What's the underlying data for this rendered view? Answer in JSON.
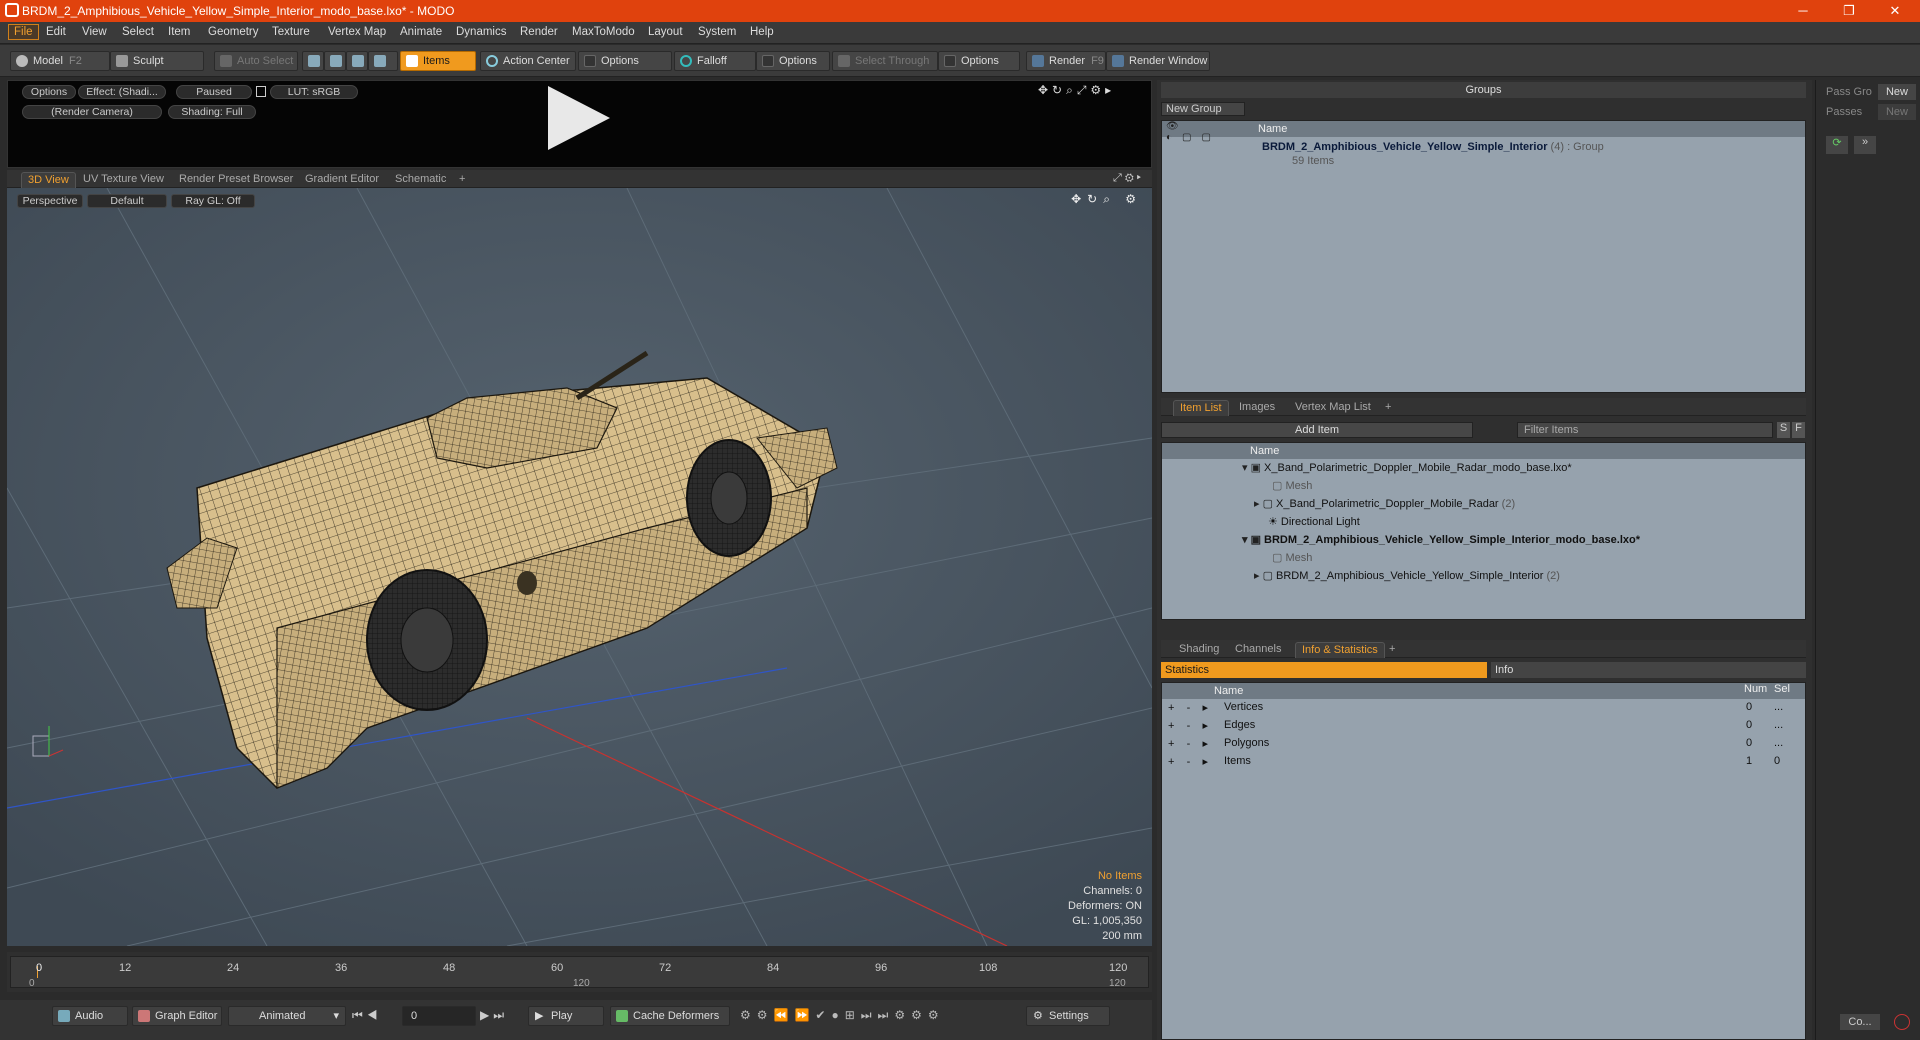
{
  "window": {
    "title": "BRDM_2_Amphibious_Vehicle_Yellow_Simple_Interior_modo_base.lxo* - MODO",
    "minimize": "─",
    "restore": "❐",
    "close": "✕"
  },
  "menu": [
    "File",
    "Edit",
    "View",
    "Select",
    "Item",
    "Geometry",
    "Texture",
    "Vertex Map",
    "Animate",
    "Dynamics",
    "Render",
    "MaxToModo",
    "Layout",
    "System",
    "Help"
  ],
  "toolbar": {
    "model": "Model",
    "model_key": "F2",
    "sculpt": "Sculpt",
    "auto_select": "Auto Select",
    "items": "Items",
    "action_center": "Action Center",
    "options1": "Options",
    "falloff": "Falloff",
    "options2": "Options",
    "select_through": "Select Through",
    "options3": "Options",
    "render": "Render",
    "render_key": "F9",
    "render_window": "Render Window"
  },
  "viewer": {
    "options": "Options",
    "effect": "Effect: (Shadi...",
    "paused": "Paused",
    "lut": "LUT: sRGB",
    "camera": "(Render Camera)",
    "shading": "Shading: Full"
  },
  "view_tabs": [
    "3D View",
    "UV Texture View",
    "Render Preset Browser",
    "Gradient Editor",
    "Schematic",
    "+"
  ],
  "viewport": {
    "perspective": "Perspective",
    "default": "Default",
    "raygl": "Ray GL: Off",
    "no_items": "No Items",
    "channels": "Channels: 0",
    "deformers": "Deformers: ON",
    "gl": "GL: 1,005,350",
    "unit": "200 mm"
  },
  "timeline": {
    "ticks": [
      "0",
      "12",
      "24",
      "36",
      "48",
      "60",
      "72",
      "84",
      "96",
      "108",
      "120"
    ],
    "sub_left": "0",
    "sub_mid": "120",
    "sub_right": "120"
  },
  "bottom": {
    "audio": "Audio",
    "graph_editor": "Graph Editor",
    "animated": "Animated",
    "frame": "0",
    "play": "Play",
    "cache": "Cache Deformers",
    "settings": "Settings"
  },
  "groups": {
    "title": "Groups",
    "new_group": "New Group",
    "col_name": "Name",
    "item_name": "BRDM_2_Amphibious_Vehicle_Yellow_Simple_Interior",
    "item_count": "(4)",
    "item_type": ": Group",
    "item_sub": "59 Items"
  },
  "item_list": {
    "tabs": [
      "Item List",
      "Images",
      "Vertex Map List",
      "+"
    ],
    "add_item": "Add Item",
    "filter": "Filter Items",
    "s": "S",
    "f": "F",
    "col_name": "Name",
    "rows": [
      {
        "label": "X_Band_Polarimetric_Doppler_Mobile_Radar_modo_base.lxo*",
        "extra": ""
      },
      {
        "label": "Mesh",
        "extra": ""
      },
      {
        "label": "X_Band_Polarimetric_Doppler_Mobile_Radar",
        "extra": "(2)"
      },
      {
        "label": "Directional Light",
        "extra": ""
      },
      {
        "label": "BRDM_2_Amphibious_Vehicle_Yellow_Simple_Interior_modo_base.lxo*",
        "extra": ""
      },
      {
        "label": "Mesh",
        "extra": ""
      },
      {
        "label": "BRDM_2_Amphibious_Vehicle_Yellow_Simple_Interior",
        "extra": "(2)"
      }
    ]
  },
  "stats": {
    "tabs": [
      "Shading",
      "Channels",
      "Info & Statistics",
      "+"
    ],
    "statistics": "Statistics",
    "info": "Info",
    "col_name": "Name",
    "col_num": "Num",
    "col_sel": "Sel",
    "rows": [
      {
        "name": "Vertices",
        "num": "0",
        "sel": "..."
      },
      {
        "name": "Edges",
        "num": "0",
        "sel": "..."
      },
      {
        "name": "Polygons",
        "num": "0",
        "sel": "..."
      },
      {
        "name": "Items",
        "num": "1",
        "sel": "0"
      }
    ]
  },
  "far_right": {
    "pass_group": "Pass Gro",
    "new1": "New",
    "passes": "Passes",
    "new2": "New",
    "bottom_btn": "Co..."
  }
}
